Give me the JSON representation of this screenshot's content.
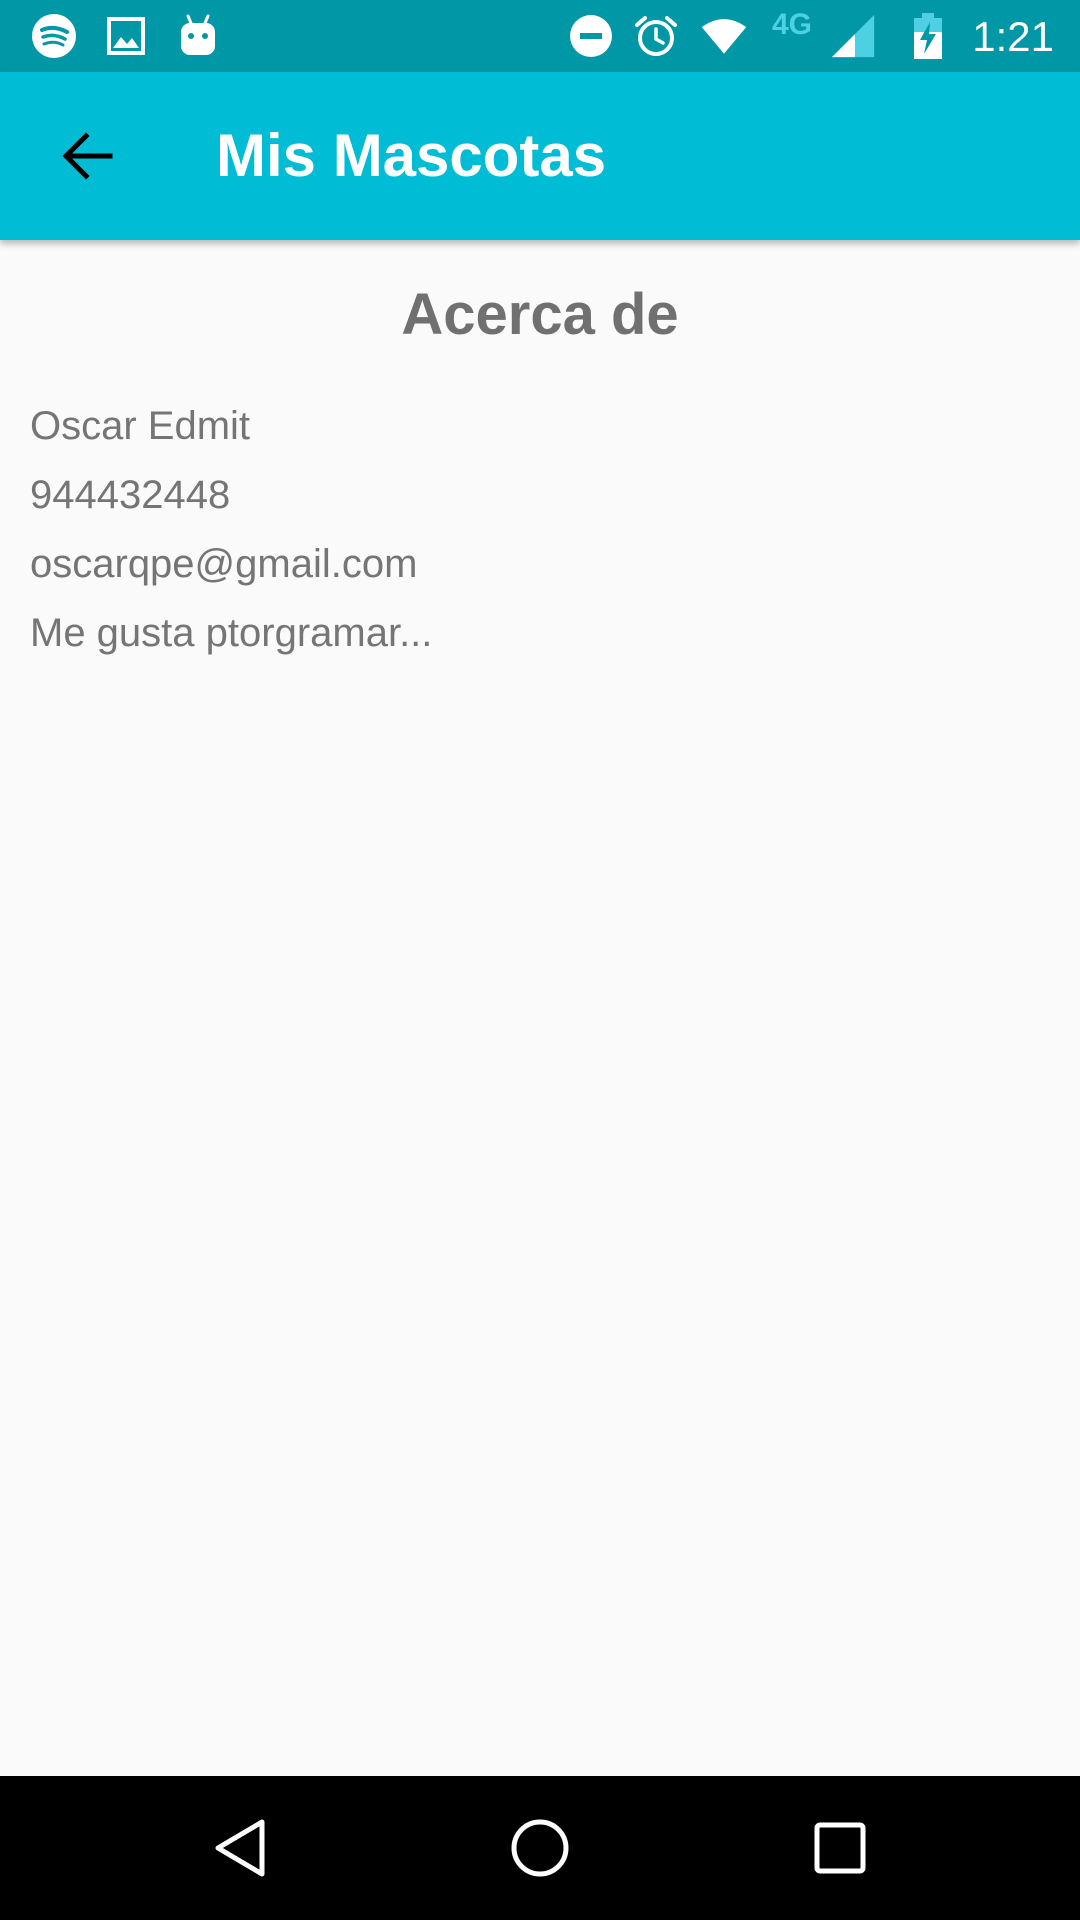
{
  "status_bar": {
    "network_label": "4G",
    "time": "1:21",
    "left_icons": [
      "spotify-icon",
      "image-icon",
      "android-icon"
    ],
    "right_icons": [
      "do-not-disturb-icon",
      "alarm-icon",
      "wifi-icon",
      "signal-icon",
      "battery-charging-icon"
    ],
    "background": "#0097a7"
  },
  "app_bar": {
    "title": "Mis Mascotas",
    "nav_icon": "arrow-back-icon",
    "background": "#00bcd4"
  },
  "content": {
    "heading": "Acerca de",
    "lines": [
      "Oscar Edmit",
      "944432448",
      "oscarqpe@gmail.com",
      "Me gusta ptorgramar..."
    ]
  },
  "nav_bar": {
    "icons": [
      "back-triangle-icon",
      "home-circle-icon",
      "recents-square-icon"
    ]
  }
}
